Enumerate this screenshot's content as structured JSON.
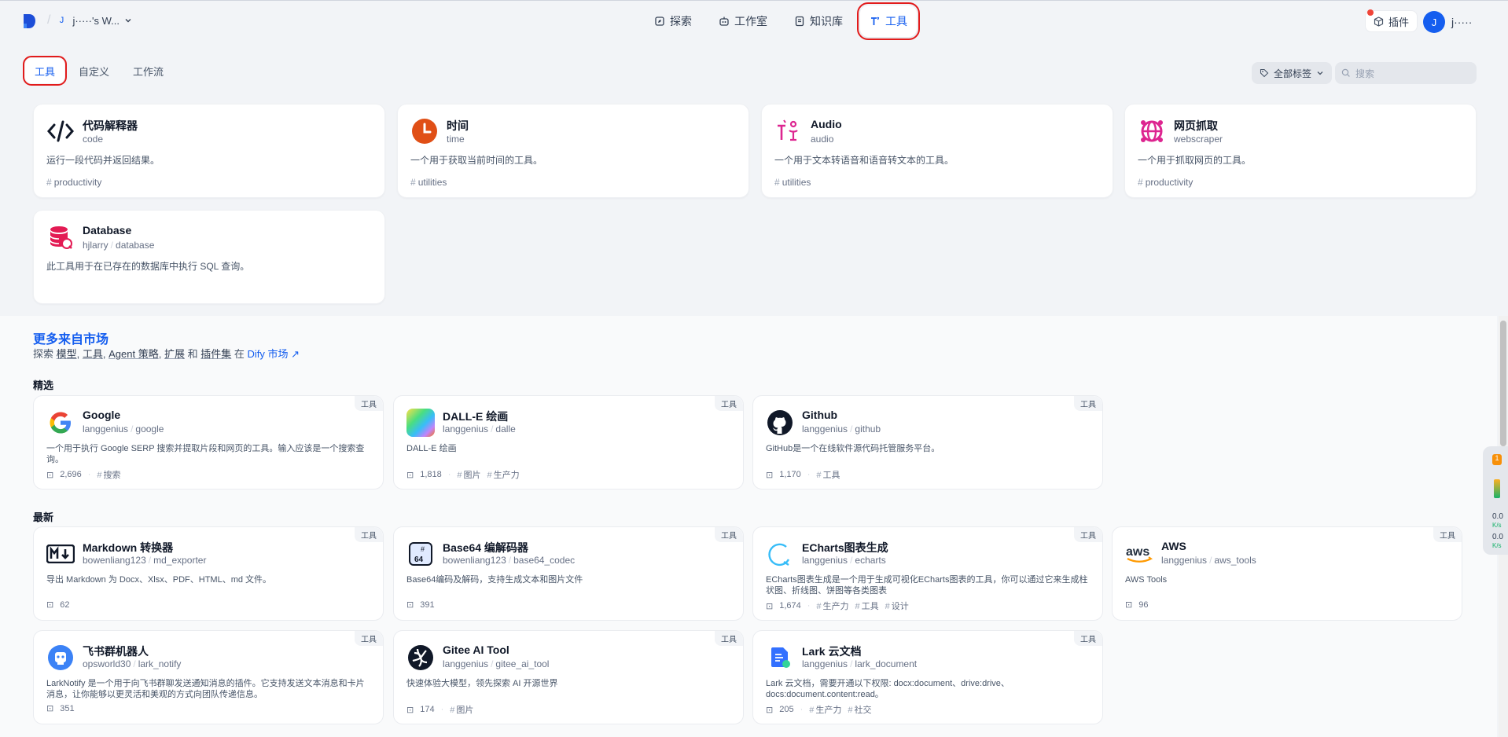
{
  "topbar": {
    "workspace_initial": "J",
    "workspace_name": "j·····'s W...",
    "nav": [
      {
        "label": "探索",
        "icon": "compass-icon"
      },
      {
        "label": "工作室",
        "icon": "robot-icon"
      },
      {
        "label": "知识库",
        "icon": "book-icon"
      },
      {
        "label": "工具",
        "icon": "tools-icon",
        "active": true
      }
    ],
    "plugins_label": "插件",
    "user_initial": "J",
    "user_name": "j·····"
  },
  "subtabs": [
    {
      "label": "工具",
      "active": true
    },
    {
      "label": "自定义"
    },
    {
      "label": "工作流"
    }
  ],
  "filter": {
    "label": "全部标签"
  },
  "search": {
    "placeholder": "搜索"
  },
  "tools": [
    {
      "title": "代码解释器",
      "sub": "code",
      "desc": "运行一段代码并返回结果。",
      "tag": "productivity",
      "icon": "code-icon"
    },
    {
      "title": "时间",
      "sub": "time",
      "desc": "一个用于获取当前时间的工具。",
      "tag": "utilities",
      "icon": "clock-icon"
    },
    {
      "title": "Audio",
      "sub": "audio",
      "desc": "一个用于文本转语音和语音转文本的工具。",
      "tag": "utilities",
      "icon": "audio-icon"
    },
    {
      "title": "网页抓取",
      "sub": "webscraper",
      "desc": "一个用于抓取网页的工具。",
      "tag": "productivity",
      "icon": "globe-icon"
    },
    {
      "title": "Database",
      "sub_author": "hjlarry",
      "sub_name": "database",
      "desc": "此工具用于在已存在的数据库中执行 SQL 查询。",
      "tag": "",
      "icon": "database-icon"
    }
  ],
  "market": {
    "title": "更多来自市场",
    "sub_prefix": "探索",
    "sub_items": [
      "模型",
      "工具",
      "Agent 策略",
      "扩展",
      "插件集"
    ],
    "sub_and": "和",
    "sub_in": "在",
    "sub_link": "Dify 市场",
    "featured_label": "精选",
    "latest_label": "最新",
    "badge": "工具",
    "featured": [
      {
        "title": "Google",
        "author": "langgenius",
        "name": "google",
        "desc": "一个用于执行 Google SERP 搜索并提取片段和网页的工具。输入应该是一个搜索查询。",
        "installs": "2,696",
        "tags": [
          "搜索"
        ],
        "icon": "google-icon"
      },
      {
        "title": "DALL-E 绘画",
        "author": "langgenius",
        "name": "dalle",
        "desc": "DALL-E 绘画",
        "installs": "1,818",
        "tags": [
          "图片",
          "生产力"
        ],
        "icon": "dalle-icon"
      },
      {
        "title": "Github",
        "author": "langgenius",
        "name": "github",
        "desc": "GitHub是一个在线软件源代码托管服务平台。",
        "installs": "1,170",
        "tags": [
          "工具"
        ],
        "icon": "github-icon"
      }
    ],
    "latest": [
      {
        "title": "Markdown 转换器",
        "author": "bowenliang123",
        "name": "md_exporter",
        "desc": "导出 Markdown 为 Docx、Xlsx、PDF、HTML、md 文件。",
        "installs": "62",
        "tags": [],
        "icon": "markdown-icon"
      },
      {
        "title": "Base64 编解码器",
        "author": "bowenliang123",
        "name": "base64_codec",
        "desc": "Base64编码及解码，支持生成文本和图片文件",
        "installs": "391",
        "tags": [],
        "icon": "base64-icon"
      },
      {
        "title": "ECharts图表生成",
        "author": "langgenius",
        "name": "echarts",
        "desc": "ECharts图表生成是一个用于生成可视化ECharts图表的工具，你可以通过它来生成柱状图、折线图、饼图等各类图表",
        "installs": "1,674",
        "tags": [
          "生产力",
          "工具",
          "设计"
        ],
        "icon": "echarts-icon"
      },
      {
        "title": "AWS",
        "author": "langgenius",
        "name": "aws_tools",
        "desc": "AWS Tools",
        "installs": "96",
        "tags": [],
        "icon": "aws-icon"
      },
      {
        "title": "飞书群机器人",
        "author": "opsworld30",
        "name": "lark_notify",
        "desc": "LarkNotify 是一个用于向飞书群聊发送通知消息的插件。它支持发送文本消息和卡片消息，让你能够以更灵活和美观的方式向团队传递信息。",
        "installs": "351",
        "tags": [],
        "icon": "lark-bot-icon"
      },
      {
        "title": "Gitee AI Tool",
        "author": "langgenius",
        "name": "gitee_ai_tool",
        "desc": "快速体验大模型，领先探索 AI 开源世界",
        "installs": "174",
        "tags": [
          "图片"
        ],
        "icon": "gitee-icon"
      },
      {
        "title": "Lark 云文档",
        "author": "langgenius",
        "name": "lark_document",
        "desc": "Lark 云文档，需要开通以下权限: docx:document、drive:drive、docs:document.content:read。",
        "installs": "205",
        "tags": [
          "生产力",
          "社交"
        ],
        "icon": "lark-doc-icon"
      }
    ]
  },
  "widget": {
    "badge": "1",
    "v1": "0.0",
    "k1": "K/s",
    "v2": "0.0",
    "k2": "K/s"
  },
  "colors": {
    "accent": "#155eef",
    "highlight_box": "#e21b1b",
    "bg": "#f2f4f7"
  }
}
